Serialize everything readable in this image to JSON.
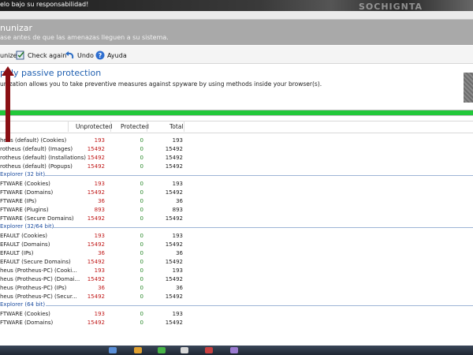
{
  "topbar": {
    "warning_text": "elo bajo su responsabilidad!",
    "watermark": "SOCHIGNTA"
  },
  "header": {
    "title": "nunizar",
    "subtitle": "ase antes de que las amenazas lleguen a su sistema."
  },
  "toolbar": {
    "immunize": "unize",
    "check_again": "Check again",
    "undo": "Undo",
    "help": "Ayuda"
  },
  "panel": {
    "title": "pply passive protection",
    "description": "unization allows you to take preventive measures against spyware by using methods inside your browser(s)."
  },
  "progress": {
    "value": 1.0,
    "color": "#22c83a"
  },
  "table": {
    "columns": {
      "unprotected": "Unprotected",
      "protected": "Protected",
      "total": "Total"
    },
    "sections": [
      {
        "label": "",
        "rows": [
          {
            "name": "heus (default) (Cookies)",
            "unprotected": "193",
            "protected": "0",
            "total": "193"
          },
          {
            "name": "rotheus (default) (Images)",
            "unprotected": "15492",
            "protected": "0",
            "total": "15492"
          },
          {
            "name": "rotheus (default) (Installations)",
            "unprotected": "15492",
            "protected": "0",
            "total": "15492"
          },
          {
            "name": "rotheus (default) (Popups)",
            "unprotected": "15492",
            "protected": "0",
            "total": "15492"
          }
        ]
      },
      {
        "label": "Explorer (32 bit)",
        "rows": [
          {
            "name": "FTWARE (Cookies)",
            "unprotected": "193",
            "protected": "0",
            "total": "193"
          },
          {
            "name": "FTWARE (Domains)",
            "unprotected": "15492",
            "protected": "0",
            "total": "15492"
          },
          {
            "name": "FTWARE (IPs)",
            "unprotected": "36",
            "protected": "0",
            "total": "36"
          },
          {
            "name": "FTWARE (Plugins)",
            "unprotected": "893",
            "protected": "0",
            "total": "893"
          },
          {
            "name": "FTWARE (Secure Domains)",
            "unprotected": "15492",
            "protected": "0",
            "total": "15492"
          }
        ]
      },
      {
        "label": "Explorer (32/64 bit)",
        "rows": [
          {
            "name": "EFAULT (Cookies)",
            "unprotected": "193",
            "protected": "0",
            "total": "193"
          },
          {
            "name": "EFAULT (Domains)",
            "unprotected": "15492",
            "protected": "0",
            "total": "15492"
          },
          {
            "name": "EFAULT (IPs)",
            "unprotected": "36",
            "protected": "0",
            "total": "36"
          },
          {
            "name": "EFAULT (Secure Domains)",
            "unprotected": "15492",
            "protected": "0",
            "total": "15492"
          },
          {
            "name": "heus (Protheus-PC) (Cooki...",
            "unprotected": "193",
            "protected": "0",
            "total": "193"
          },
          {
            "name": "heus (Protheus-PC) (Domai...",
            "unprotected": "15492",
            "protected": "0",
            "total": "15492"
          },
          {
            "name": "heus (Protheus-PC) (IPs)",
            "unprotected": "36",
            "protected": "0",
            "total": "36"
          },
          {
            "name": "heus (Protheus-PC) (Secur...",
            "unprotected": "15492",
            "protected": "0",
            "total": "15492"
          }
        ]
      },
      {
        "label": "Explorer (64 bit)",
        "rows": [
          {
            "name": "FTWARE (Cookies)",
            "unprotected": "193",
            "protected": "0",
            "total": "193"
          },
          {
            "name": "FTWARE (Domains)",
            "unprotected": "15492",
            "protected": "0",
            "total": "15492"
          }
        ]
      }
    ]
  },
  "icons": {
    "check_again": "check-document-icon",
    "undo": "undo-arrow-icon",
    "help": "help-question-icon",
    "annotation": "red-arrow-icon"
  },
  "colors": {
    "unprotected": "#c01818",
    "protected": "#2c8a2c",
    "section": "#1f4fa0",
    "accent_title": "#1f5fb0"
  }
}
